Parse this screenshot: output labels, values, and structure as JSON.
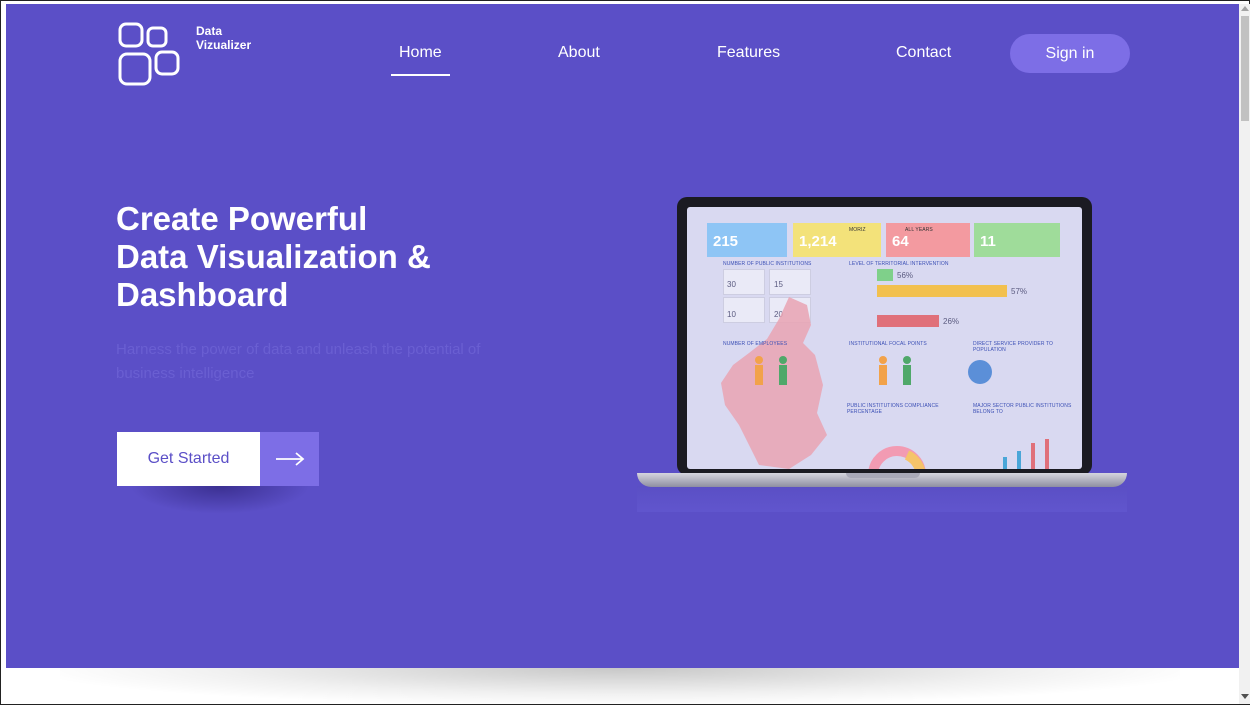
{
  "brand": {
    "name_line1": "Data",
    "name_line2": "Vizualizer"
  },
  "nav": {
    "items": [
      {
        "label": "Home",
        "active": true
      },
      {
        "label": "About"
      },
      {
        "label": "Features"
      },
      {
        "label": "Contact"
      }
    ],
    "signin_label": "Sign in"
  },
  "hero": {
    "headline_line1": "Create Powerful",
    "headline_line2": "Data Visualization &",
    "headline_line3": "Dashboard",
    "subtext": "Harness the power of data and unleash the potential of business intelligence",
    "cta_label": "Get Started",
    "cta_icon": "arrow-right-icon"
  },
  "dashboard": {
    "kpis": [
      {
        "value": "215",
        "color": "#8ec5f5"
      },
      {
        "value": "1,214",
        "color": "#f3e27a"
      },
      {
        "value": "64",
        "color": "#f39aa0"
      },
      {
        "value": "11",
        "color": "#9fdc9a"
      }
    ],
    "filters": {
      "f1": "MORIZ",
      "f2": "ALL YEARS"
    },
    "labels": {
      "l1": "NUMBER OF PUBLIC INSTITUTIONS",
      "l2": "LEVEL OF TERRITORIAL INTERVENTION",
      "l3": "NUMBER OF EMPLOYEES",
      "l4": "INSTITUTIONAL FOCAL POINTS",
      "l5": "DIRECT SERVICE PROVIDER TO POPULATION",
      "l6": "PUBLIC INSTITUTIONS COMPLIANCE PERCENTAGE",
      "l7": "MAJOR SECTOR PUBLIC INSTITUTIONS BELONG TO"
    },
    "mini": {
      "m1": "30",
      "m2": "15",
      "m3": "10",
      "m4": "20",
      "p1": "56%",
      "p2": "57%",
      "p3": "26%"
    }
  },
  "colors": {
    "hero_bg": "#5b4fc7",
    "accent": "#7d6ee6",
    "white": "#ffffff"
  }
}
